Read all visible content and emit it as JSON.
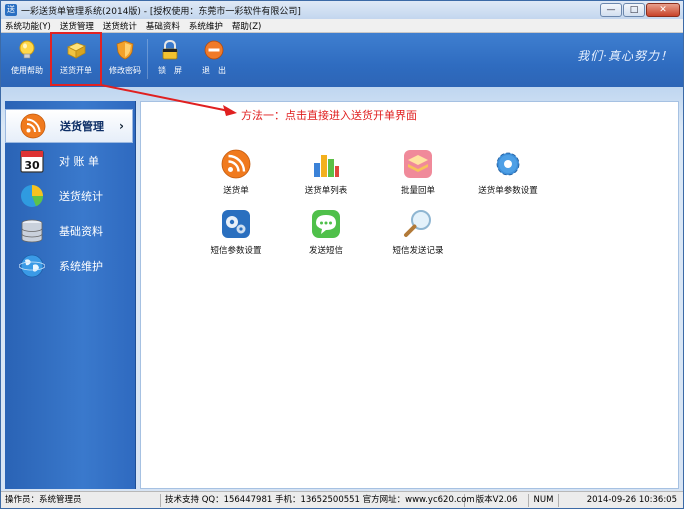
{
  "window": {
    "title": "一彩送货单管理系统(2014版) - [授权使用：东莞市一彩软件有限公司]",
    "app_icon": "送",
    "controls": {
      "minimize": "—",
      "maximize": "□",
      "close": "✕"
    }
  },
  "menu": {
    "items": [
      "系统功能(Y)",
      "送货管理",
      "送货统计",
      "基础资料",
      "系统维护",
      "帮助(Z)"
    ]
  },
  "toolbar": {
    "items": [
      {
        "label": "使用帮助",
        "icon": "lightbulb-icon"
      },
      {
        "label": "送货开单",
        "icon": "folder-icon"
      },
      {
        "label": "修改密码",
        "icon": "shield-icon"
      },
      {
        "label": "锁　屏",
        "icon": "lock-icon"
      },
      {
        "label": "退　出",
        "icon": "exit-icon"
      }
    ],
    "slogan": "我们·真心努力！"
  },
  "annotation": {
    "text": "方法一：点击直接进入送货开单界面",
    "color": "#e02020"
  },
  "sidebar": {
    "items": [
      {
        "label": "送货管理",
        "icon": "rss-icon",
        "active": true,
        "chevron": "›"
      },
      {
        "label": "对 账 单",
        "icon": "calendar-icon",
        "active": false,
        "calendar_day": "30"
      },
      {
        "label": "送货统计",
        "icon": "pie-chart-icon",
        "active": false
      },
      {
        "label": "基础资料",
        "icon": "database-icon",
        "active": false
      },
      {
        "label": "系统维护",
        "icon": "globe-icon",
        "active": false
      }
    ]
  },
  "main": {
    "modules": [
      {
        "label": "送货单",
        "icon": "rss-icon"
      },
      {
        "label": "送货单列表",
        "icon": "bar-chart-icon"
      },
      {
        "label": "批量回单",
        "icon": "stack-icon"
      },
      {
        "label": "送货单参数设置",
        "icon": "gear-icon"
      },
      {
        "label": "短信参数设置",
        "icon": "gears-icon"
      },
      {
        "label": "发送短信",
        "icon": "chat-icon"
      },
      {
        "label": "短信发送记录",
        "icon": "magnifier-icon"
      }
    ]
  },
  "status": {
    "operator": "操作员：系统管理员",
    "support": "技术支持 QQ：156447981 手机：13652500551 官方网址：www.yc620.com",
    "version": "版本V2.06",
    "numlock": "NUM",
    "datetime": "2014-09-26 10:36:05"
  }
}
